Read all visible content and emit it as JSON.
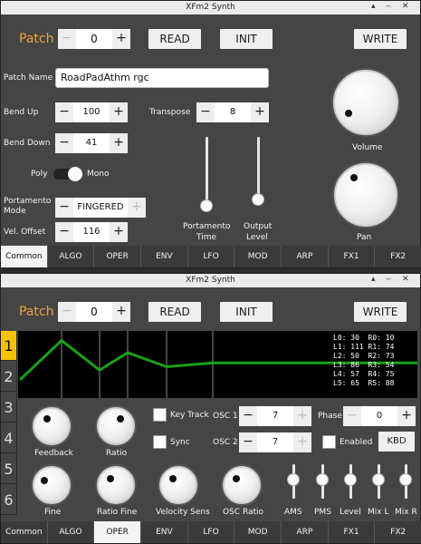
{
  "window_top": {
    "title": "XFm2 Synth",
    "patch": {
      "label": "Patch",
      "value": "0",
      "read": "READ",
      "init": "INIT",
      "write": "WRITE"
    },
    "patch_name": {
      "label": "Patch Name",
      "value": "RoadPadAthm rgc"
    },
    "bend_up": {
      "label": "Bend Up",
      "value": "100"
    },
    "bend_down": {
      "label": "Bend Down",
      "value": "41"
    },
    "transpose": {
      "label": "Transpose",
      "value": "8"
    },
    "poly_mono": {
      "left": "Poly",
      "right": "Mono",
      "state": "mono"
    },
    "portamento_mode": {
      "label1": "Portamento",
      "label2": "Mode",
      "value": "FINGERED"
    },
    "vel_offset": {
      "label": "Vel. Offset",
      "value": "116"
    },
    "sliders": {
      "portamento_time_1": "Portamento",
      "portamento_time_2": "Time",
      "output_level_1": "Output",
      "output_level_2": "Level",
      "portamento_time_fraction": 0.05,
      "output_level_fraction": 0.08
    },
    "volume_label": "Volume",
    "pan_label": "Pan",
    "active_tab": "Common"
  },
  "window_bottom": {
    "title": "XFm2 Synth",
    "patch": {
      "label": "Patch",
      "value": "0",
      "read": "READ",
      "init": "INIT",
      "write": "WRITE"
    },
    "operators": [
      "1",
      "2",
      "3",
      "4",
      "5",
      "6"
    ],
    "active_operator": "1",
    "envelope": {
      "line1": "L0: 30  R0: 10",
      "line2": "L1: 111 R1: 74",
      "line3": "L2: 50  R2: 73",
      "line4": "L3: 86  R3: 54",
      "line5": "L4: 57  R4: 75",
      "line6": "L5: 65  R5: 88",
      "levels": [
        30,
        111,
        50,
        86,
        57,
        65
      ],
      "color": "#1aa01a"
    },
    "knobs": {
      "feedback": "Feedback",
      "ratio": "Ratio",
      "fine": "Fine",
      "ratio_fine": "Ratio Fine",
      "velocity_sens": "Velocity Sens",
      "osc_ratio": "OSC Ratio"
    },
    "key_track": "Key Track",
    "sync": "Sync",
    "osc1": {
      "label": "OSC 1",
      "value": "7"
    },
    "osc2": {
      "label": "OSC 2",
      "value": "7"
    },
    "phase": {
      "label": "Phase",
      "value": "0"
    },
    "enabled": "Enabled",
    "kbd": "KBD",
    "sliders": {
      "ams": "AMS",
      "pms": "PMS",
      "level": "Level",
      "mix_l": "Mix L",
      "mix_r": "Mix R"
    },
    "active_tab": "OPER"
  },
  "tabs": [
    "Common",
    "ALGO",
    "OPER",
    "ENV",
    "LFO",
    "MOD",
    "ARP",
    "FX1",
    "FX2"
  ],
  "colors": {
    "accent": "#f0a040",
    "operator_active": "#f5c400",
    "panel": "#454545"
  }
}
